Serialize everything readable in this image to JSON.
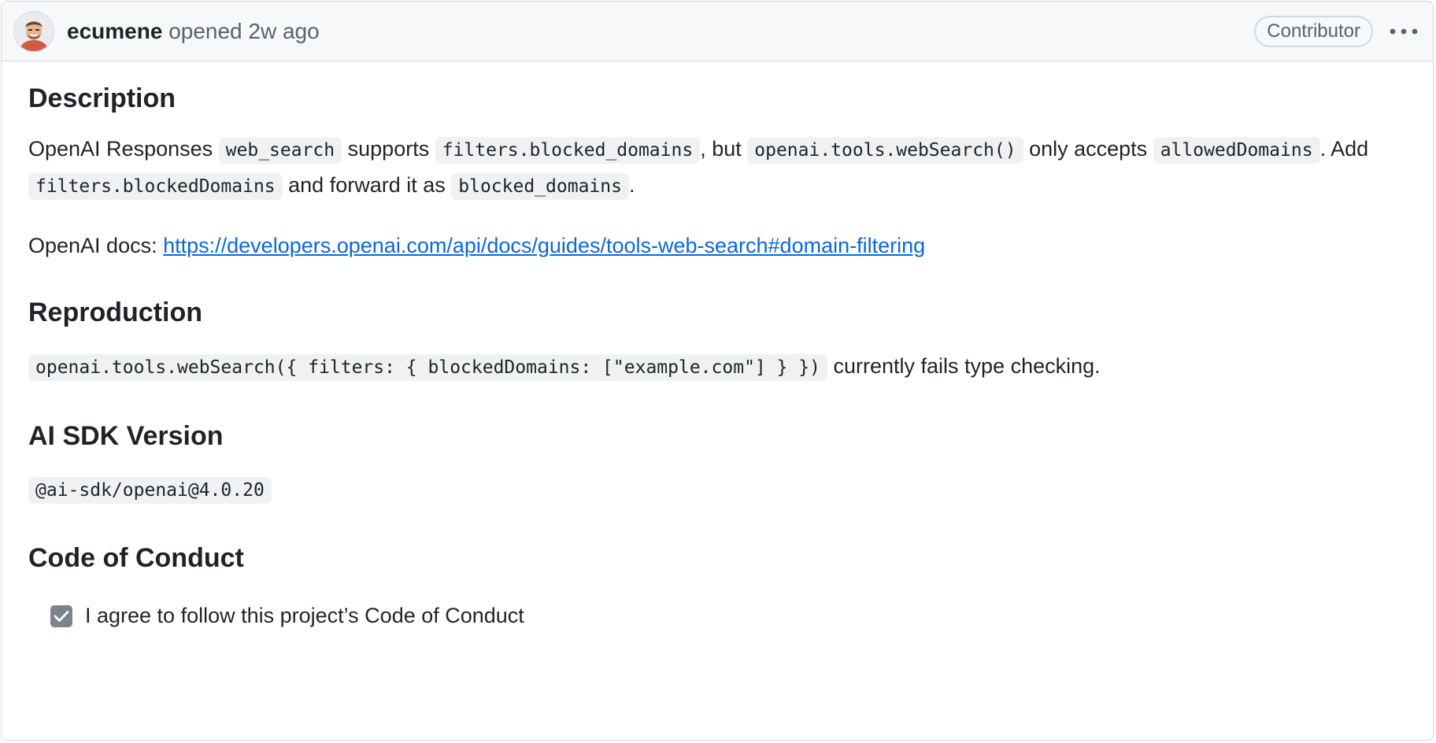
{
  "header": {
    "author": "ecumene",
    "opened_text": "opened 2w ago",
    "badge": "Contributor",
    "menu_icon": "kebab-horizontal-icon"
  },
  "sections": {
    "description": {
      "heading": "Description",
      "p1": {
        "t1": "OpenAI Responses ",
        "c1": "web_search",
        "t2": " supports ",
        "c2": "filters.blocked_domains",
        "t3": ", but ",
        "c3": "openai.tools.webSearch()",
        "t4": " only accepts ",
        "c4": "allowedDomains",
        "t5": ". Add ",
        "c5": "filters.blockedDomains",
        "t6": " and forward it as ",
        "c6": "blocked_domains",
        "t7": "."
      },
      "p2": {
        "label": "OpenAI docs: ",
        "link": "https://developers.openai.com/api/docs/guides/tools-web-search#domain-filtering"
      }
    },
    "reproduction": {
      "heading": "Reproduction",
      "code": "openai.tools.webSearch({ filters: { blockedDomains: [\"example.com\"] } })",
      "text": " currently fails type checking."
    },
    "version": {
      "heading": "AI SDK Version",
      "code": "@ai-sdk/openai@4.0.20"
    },
    "conduct": {
      "heading": "Code of Conduct",
      "checkbox_label": "I agree to follow this project’s Code of Conduct",
      "checked": true
    }
  },
  "colors": {
    "link": "#0969da",
    "border": "#d1d9e0",
    "muted": "#59636e",
    "code_bg": "#eff1f3"
  }
}
